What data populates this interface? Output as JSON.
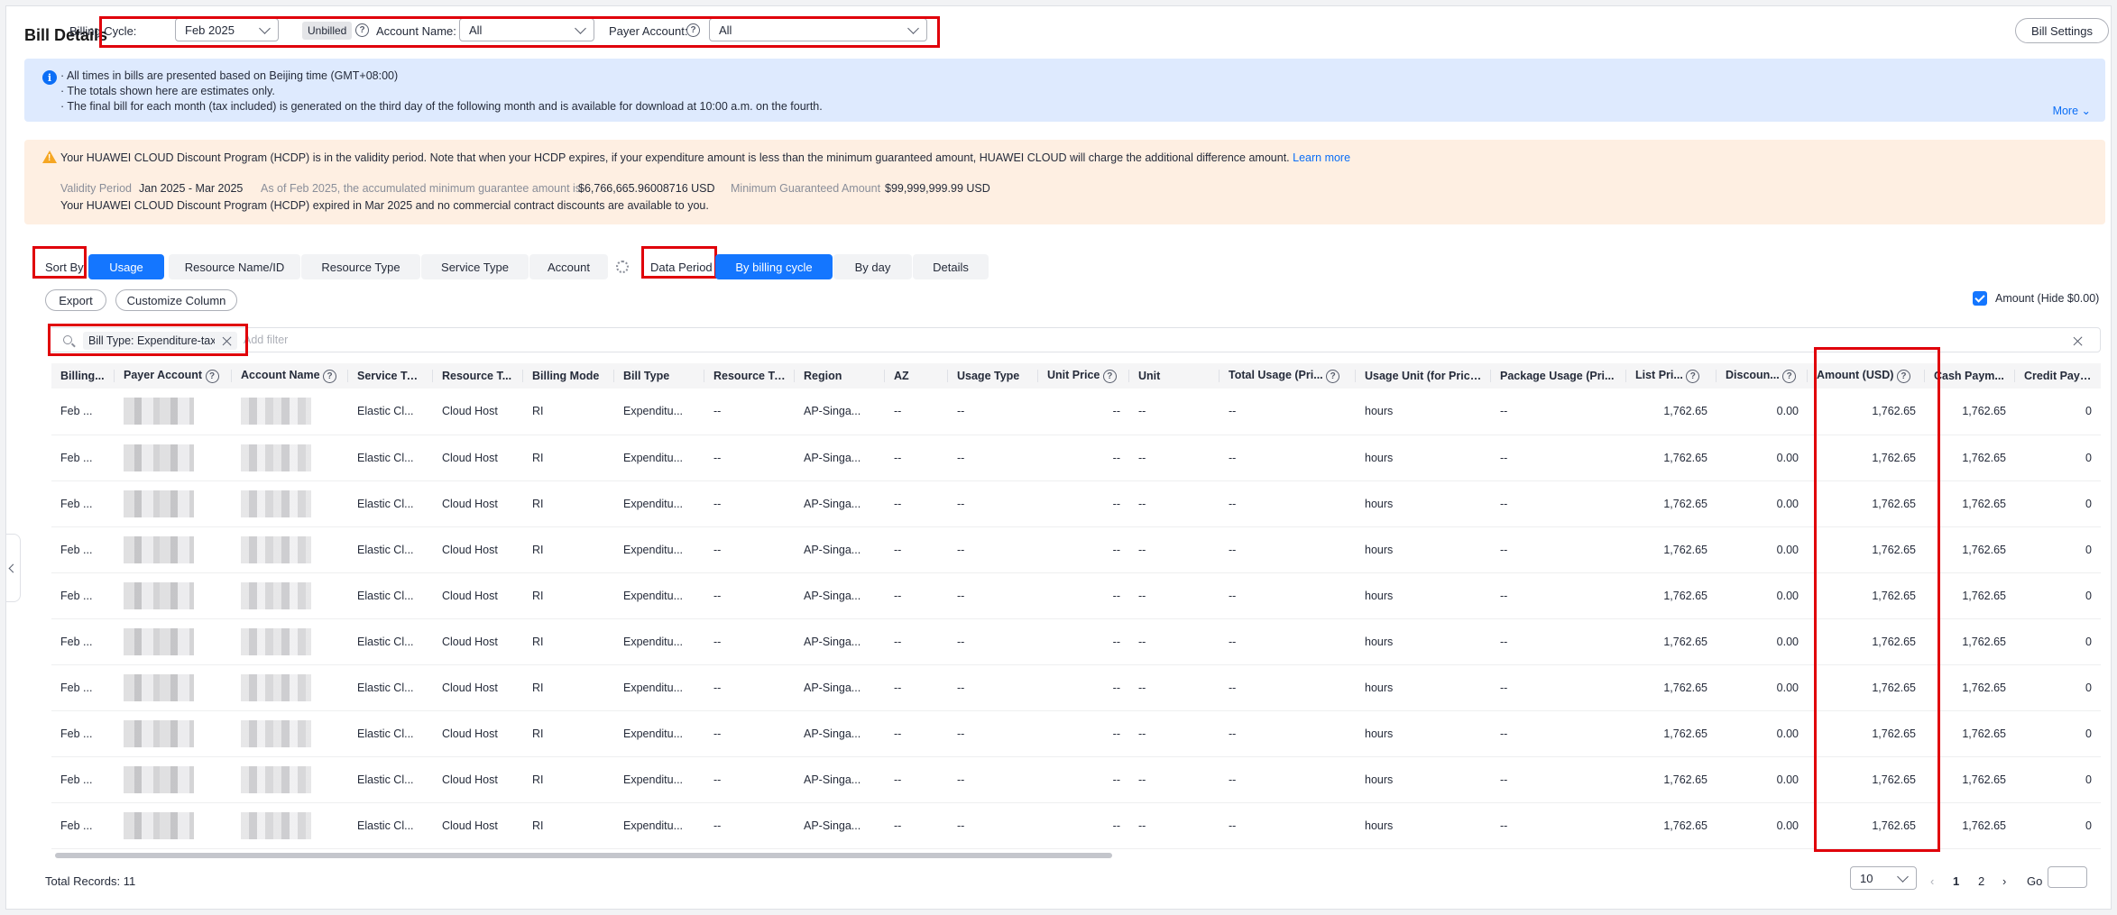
{
  "header": {
    "title": "Bill Details",
    "billing_cycle_label": "Billing Cycle:",
    "billing_cycle_value": "Feb 2025",
    "unbilled": "Unbilled",
    "account_name_label": "Account Name:",
    "account_name_value": "All",
    "payer_account_label": "Payer Account:",
    "payer_account_value": "All",
    "bill_settings": "Bill Settings"
  },
  "info": {
    "lines": [
      "· All times in bills are presented based on Beijing time (GMT+08:00)",
      "· The totals shown here are estimates only.",
      "· The final bill for each month (tax included) is generated on the third day of the following month and is available for download at 10:00 a.m. on the fourth."
    ],
    "more": "More"
  },
  "hcdp": {
    "message": "Your HUAWEI CLOUD Discount Program (HCDP) is in the validity period. Note that when your HCDP expires, if your expenditure amount is less than the minimum guaranteed amount, HUAWEI CLOUD will charge the additional difference amount.",
    "learn_more": "Learn more",
    "validity_label": "Validity Period",
    "validity_value": "Jan 2025 - Mar 2025",
    "accum_label": "As of Feb 2025, the accumulated minimum guarantee amount is",
    "accum_value": "$6,766,665.96008716 USD",
    "min_label": "Minimum Guaranteed Amount",
    "min_value": "$99,999,999.99 USD",
    "expired_note": "Your HUAWEI CLOUD Discount Program (HCDP) expired in Mar 2025 and no commercial contract discounts are available to you."
  },
  "sort": {
    "label": "Sort By",
    "tabs": [
      "Usage",
      "Resource Name/ID",
      "Resource Type",
      "Service Type",
      "Account"
    ]
  },
  "period": {
    "label": "Data Period",
    "tabs": [
      "By billing cycle",
      "By day",
      "Details"
    ]
  },
  "actions": {
    "export": "Export",
    "customize": "Customize Column",
    "hide_zero": "Amount (Hide $0.00)"
  },
  "filter": {
    "tag": "Bill Type: Expenditure-tax",
    "placeholder": "Add filter"
  },
  "table": {
    "columns": [
      "Billing...",
      "Payer Account",
      "Account Name",
      "Service Type",
      "Resource T...",
      "Billing Mode",
      "Bill Type",
      "Resource Tag",
      "Region",
      "AZ",
      "Usage Type",
      "Unit Price",
      "Unit",
      "Total Usage (Pri...",
      "Usage Unit (for Prici...",
      "Package Usage (Pri...",
      "List Pri...",
      "Discoun...",
      "Amount (USD)",
      "Cash Paym...",
      "Credit Payme"
    ],
    "row": {
      "billing": "Feb ...",
      "service": "Elastic Cl...",
      "resource_type": "Cloud Host",
      "mode": "RI",
      "bill_type": "Expenditu...",
      "tag": "--",
      "region": "AP-Singa...",
      "az": "--",
      "usage_type": "--",
      "unit_price": "--",
      "unit": "--",
      "total_usage": "--",
      "usage_unit": "hours",
      "package": "--",
      "list_price": "1,762.65",
      "discount": "0.00",
      "amount": "1,762.65",
      "cash": "1,762.65",
      "credit": "0"
    },
    "row_count": 10
  },
  "footer": {
    "total": "Total Records: 11",
    "page_size": "10",
    "pages": [
      "1",
      "2"
    ],
    "go": "Go"
  }
}
